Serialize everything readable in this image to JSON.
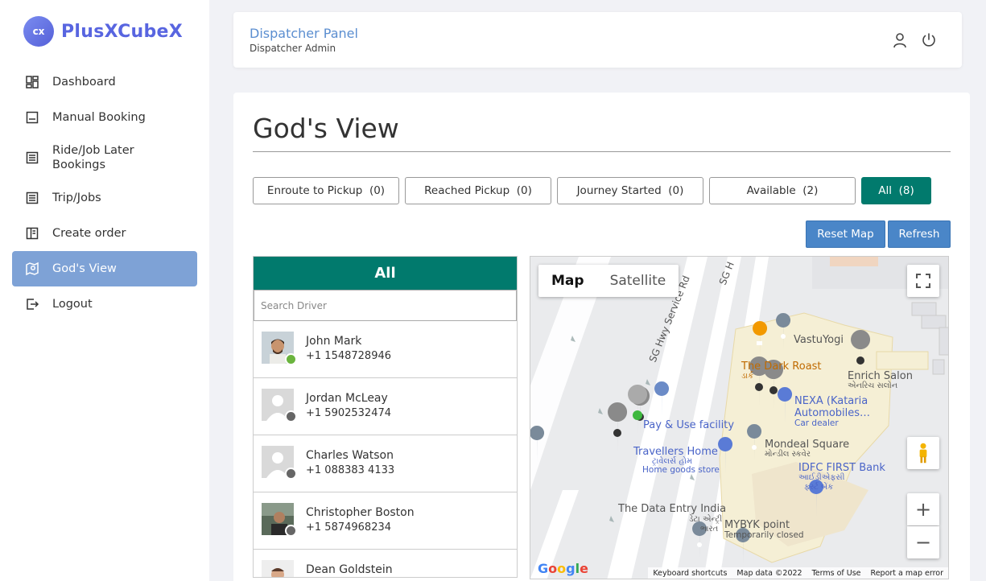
{
  "brand": {
    "logo_text": "cx",
    "name": "PlusXCubeX"
  },
  "sidebar": {
    "items": [
      {
        "label": "Dashboard"
      },
      {
        "label": "Manual Booking"
      },
      {
        "label": "Ride/Job Later Bookings"
      },
      {
        "label": "Trip/Jobs"
      },
      {
        "label": "Create order"
      },
      {
        "label": "God's View"
      },
      {
        "label": "Logout"
      }
    ],
    "active_index": 5
  },
  "header": {
    "title": "Dispatcher Panel",
    "subtitle": "Dispatcher Admin"
  },
  "page": {
    "title": "God's View"
  },
  "filters": [
    {
      "label": "Enroute to Pickup",
      "count": "(0)"
    },
    {
      "label": "Reached Pickup",
      "count": "(0)"
    },
    {
      "label": "Journey Started",
      "count": "(0)"
    },
    {
      "label": "Available",
      "count": "(2)"
    },
    {
      "label": "All",
      "count": "(8)"
    }
  ],
  "actions": {
    "reset_map": "Reset Map",
    "refresh": "Refresh"
  },
  "drivers": {
    "heading": "All",
    "search_placeholder": "Search Driver",
    "list": [
      {
        "name": "John Mark",
        "phone": "+1 1548728946",
        "status_color": "#6ab43e"
      },
      {
        "name": "Jordan McLeay",
        "phone": "+1 5902532474",
        "status_color": "#666666"
      },
      {
        "name": "Charles Watson",
        "phone": "+1 088383 4133",
        "status_color": "#666666"
      },
      {
        "name": "Christopher Boston",
        "phone": "+1 5874968234",
        "status_color": "#666666"
      },
      {
        "name": "Dean Goldstein",
        "phone": "",
        "status_color": "#666666"
      }
    ]
  },
  "map": {
    "type_map": "Map",
    "type_satellite": "Satellite",
    "labels": {
      "sg_hwy": "SG Hwy Service Rd",
      "sg_h": "SG H",
      "vastuyogi": "VastuYogi",
      "dark_roast": "The Dark Roast",
      "dark_roast_gu": "ડાર્ક",
      "enrich": "Enrich Salon",
      "enrich_gu": "એનરિચ સલોન",
      "nexa_1": "NEXA (Kataria",
      "nexa_2": "Automobiles…",
      "car_dealer": "Car dealer",
      "pay_use": "Pay & Use facility",
      "mondeal": "Mondeal Square",
      "mondeal_gu": "મોન્ડીલ સ્કવેર",
      "travellers": "Travellers Home",
      "travellers_gu": "ટ્રાવેલર્સ હોમ",
      "home_goods": "Home goods store",
      "idfc": "IDFC FIRST Bank",
      "idfc_gu_1": "આઈડીએફસી",
      "idfc_gu_2": "ફર્સ્ટ બેંક",
      "data_entry": "The Data Entry India",
      "data_entry_gu_1": "ડેટા એન્ટ્રી",
      "data_entry_gu_2": "ભારત",
      "mybyk": "MYBYK point",
      "mybyk_sub": "Temporarily closed"
    },
    "zoom_in": "+",
    "zoom_out": "−",
    "google": "Google",
    "footer": {
      "shortcuts": "Keyboard shortcuts",
      "data": "Map data ©2022",
      "terms": "Terms of Use",
      "report": "Report a map error"
    }
  },
  "colors": {
    "accent_teal": "#017a6d",
    "accent_blue": "#4a86c8",
    "sidebar_active": "#7ea2d6",
    "brand": "#5865e0"
  }
}
